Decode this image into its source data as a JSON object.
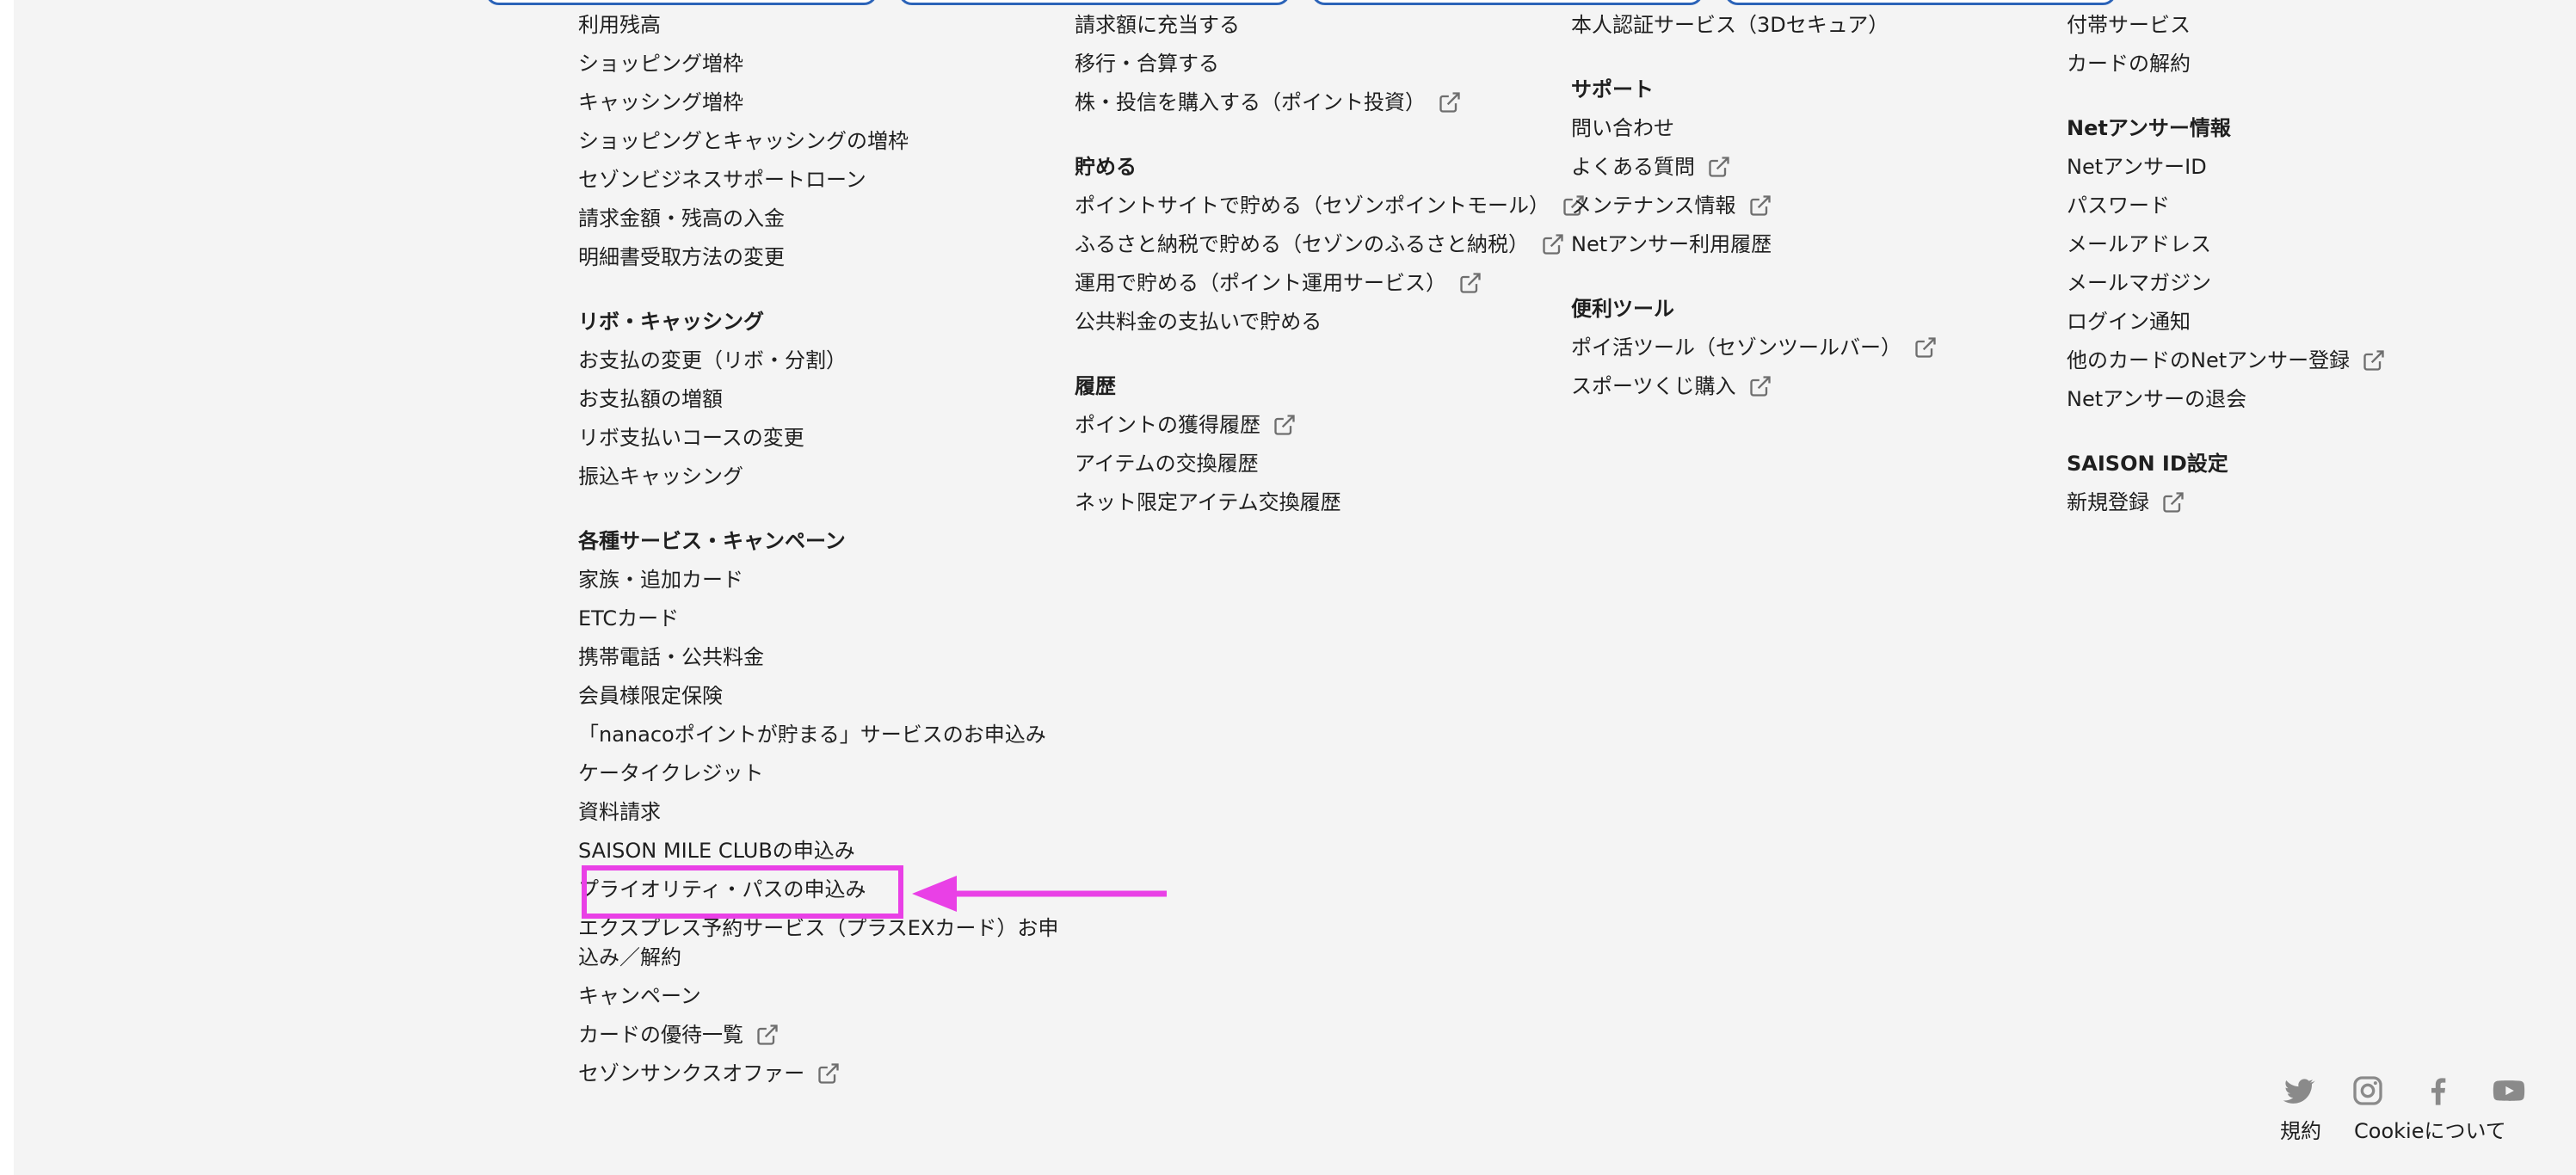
{
  "columns": [
    {
      "sections": [
        {
          "title": "",
          "links": [
            {
              "label": "利用残高",
              "ext": false
            },
            {
              "label": "ショッピング増枠",
              "ext": false
            },
            {
              "label": "キャッシング増枠",
              "ext": false
            },
            {
              "label": "ショッピングとキャッシングの増枠",
              "ext": false
            },
            {
              "label": "セゾンビジネスサポートローン",
              "ext": false
            },
            {
              "label": "請求金額・残高の入金",
              "ext": false
            },
            {
              "label": "明細書受取方法の変更",
              "ext": false
            }
          ]
        },
        {
          "title": "リボ・キャッシング",
          "links": [
            {
              "label": "お支払の変更（リボ・分割）",
              "ext": false
            },
            {
              "label": "お支払額の増額",
              "ext": false
            },
            {
              "label": "リボ支払いコースの変更",
              "ext": false
            },
            {
              "label": "振込キャッシング",
              "ext": false
            }
          ]
        },
        {
          "title": "各種サービス・キャンペーン",
          "links": [
            {
              "label": "家族・追加カード",
              "ext": false
            },
            {
              "label": "ETCカード",
              "ext": false
            },
            {
              "label": "携帯電話・公共料金",
              "ext": false
            },
            {
              "label": "会員様限定保険",
              "ext": false
            },
            {
              "label": "「nanacoポイントが貯まる」サービスのお申込み",
              "ext": false
            },
            {
              "label": "ケータイクレジット",
              "ext": false
            },
            {
              "label": "資料請求",
              "ext": false
            },
            {
              "label": "SAISON MILE CLUBの申込み",
              "ext": false
            },
            {
              "label": "プライオリティ・パスの申込み",
              "ext": false
            },
            {
              "label": "エクスプレス予約サービス（プラスEXカード）お申込み／解約",
              "ext": false
            },
            {
              "label": "キャンペーン",
              "ext": false
            },
            {
              "label": "カードの優待一覧",
              "ext": true
            },
            {
              "label": "セゾンサンクスオファー",
              "ext": true
            }
          ]
        }
      ]
    },
    {
      "sections": [
        {
          "title": "",
          "links": [
            {
              "label": "請求額に充当する",
              "ext": false
            },
            {
              "label": "移行・合算する",
              "ext": false
            },
            {
              "label": "株・投信を購入する（ポイント投資）",
              "ext": true
            }
          ]
        },
        {
          "title": "貯める",
          "links": [
            {
              "label": "ポイントサイトで貯める（セゾンポイントモール）",
              "ext": true
            },
            {
              "label": "ふるさと納税で貯める（セゾンのふるさと納税）",
              "ext": true
            },
            {
              "label": "運用で貯める（ポイント運用サービス）",
              "ext": true
            },
            {
              "label": "公共料金の支払いで貯める",
              "ext": false
            }
          ]
        },
        {
          "title": "履歴",
          "links": [
            {
              "label": "ポイントの獲得履歴",
              "ext": true
            },
            {
              "label": "アイテムの交換履歴",
              "ext": false
            },
            {
              "label": "ネット限定アイテム交換履歴",
              "ext": false
            }
          ]
        }
      ]
    },
    {
      "sections": [
        {
          "title": "",
          "links": [
            {
              "label": "本人認証サービス（3Dセキュア）",
              "ext": false
            }
          ]
        },
        {
          "title": "サポート",
          "links": [
            {
              "label": "問い合わせ",
              "ext": false
            },
            {
              "label": "よくある質問",
              "ext": true
            },
            {
              "label": "メンテナンス情報",
              "ext": true
            },
            {
              "label": "Netアンサー利用履歴",
              "ext": false
            }
          ]
        },
        {
          "title": "便利ツール",
          "links": [
            {
              "label": "ポイ活ツール（セゾンツールバー）",
              "ext": true
            },
            {
              "label": "スポーツくじ購入",
              "ext": true
            }
          ]
        }
      ]
    },
    {
      "sections": [
        {
          "title": "",
          "links": [
            {
              "label": "付帯サービス",
              "ext": false
            },
            {
              "label": "カードの解約",
              "ext": false
            }
          ]
        },
        {
          "title": "Netアンサー情報",
          "links": [
            {
              "label": "NetアンサーID",
              "ext": false
            },
            {
              "label": "パスワード",
              "ext": false
            },
            {
              "label": "メールアドレス",
              "ext": false
            },
            {
              "label": "メールマガジン",
              "ext": false
            },
            {
              "label": "ログイン通知",
              "ext": false
            },
            {
              "label": "他のカードのNetアンサー登録",
              "ext": true
            },
            {
              "label": "Netアンサーの退会",
              "ext": false
            }
          ]
        },
        {
          "title": "SAISON ID設定",
          "links": [
            {
              "label": "新規登録",
              "ext": true
            }
          ]
        }
      ]
    }
  ],
  "social_icons": [
    "twitter-icon",
    "instagram-icon",
    "facebook-icon",
    "youtube-icon"
  ],
  "footer": {
    "terms": "規約",
    "cookie": "Cookieについて"
  },
  "colors": {
    "background": "#f4f4f4",
    "text": "#1f1f1f",
    "icon_gray": "#8a8a8a",
    "highlight": "#e940e6",
    "top_button_border": "#2b63b8"
  }
}
